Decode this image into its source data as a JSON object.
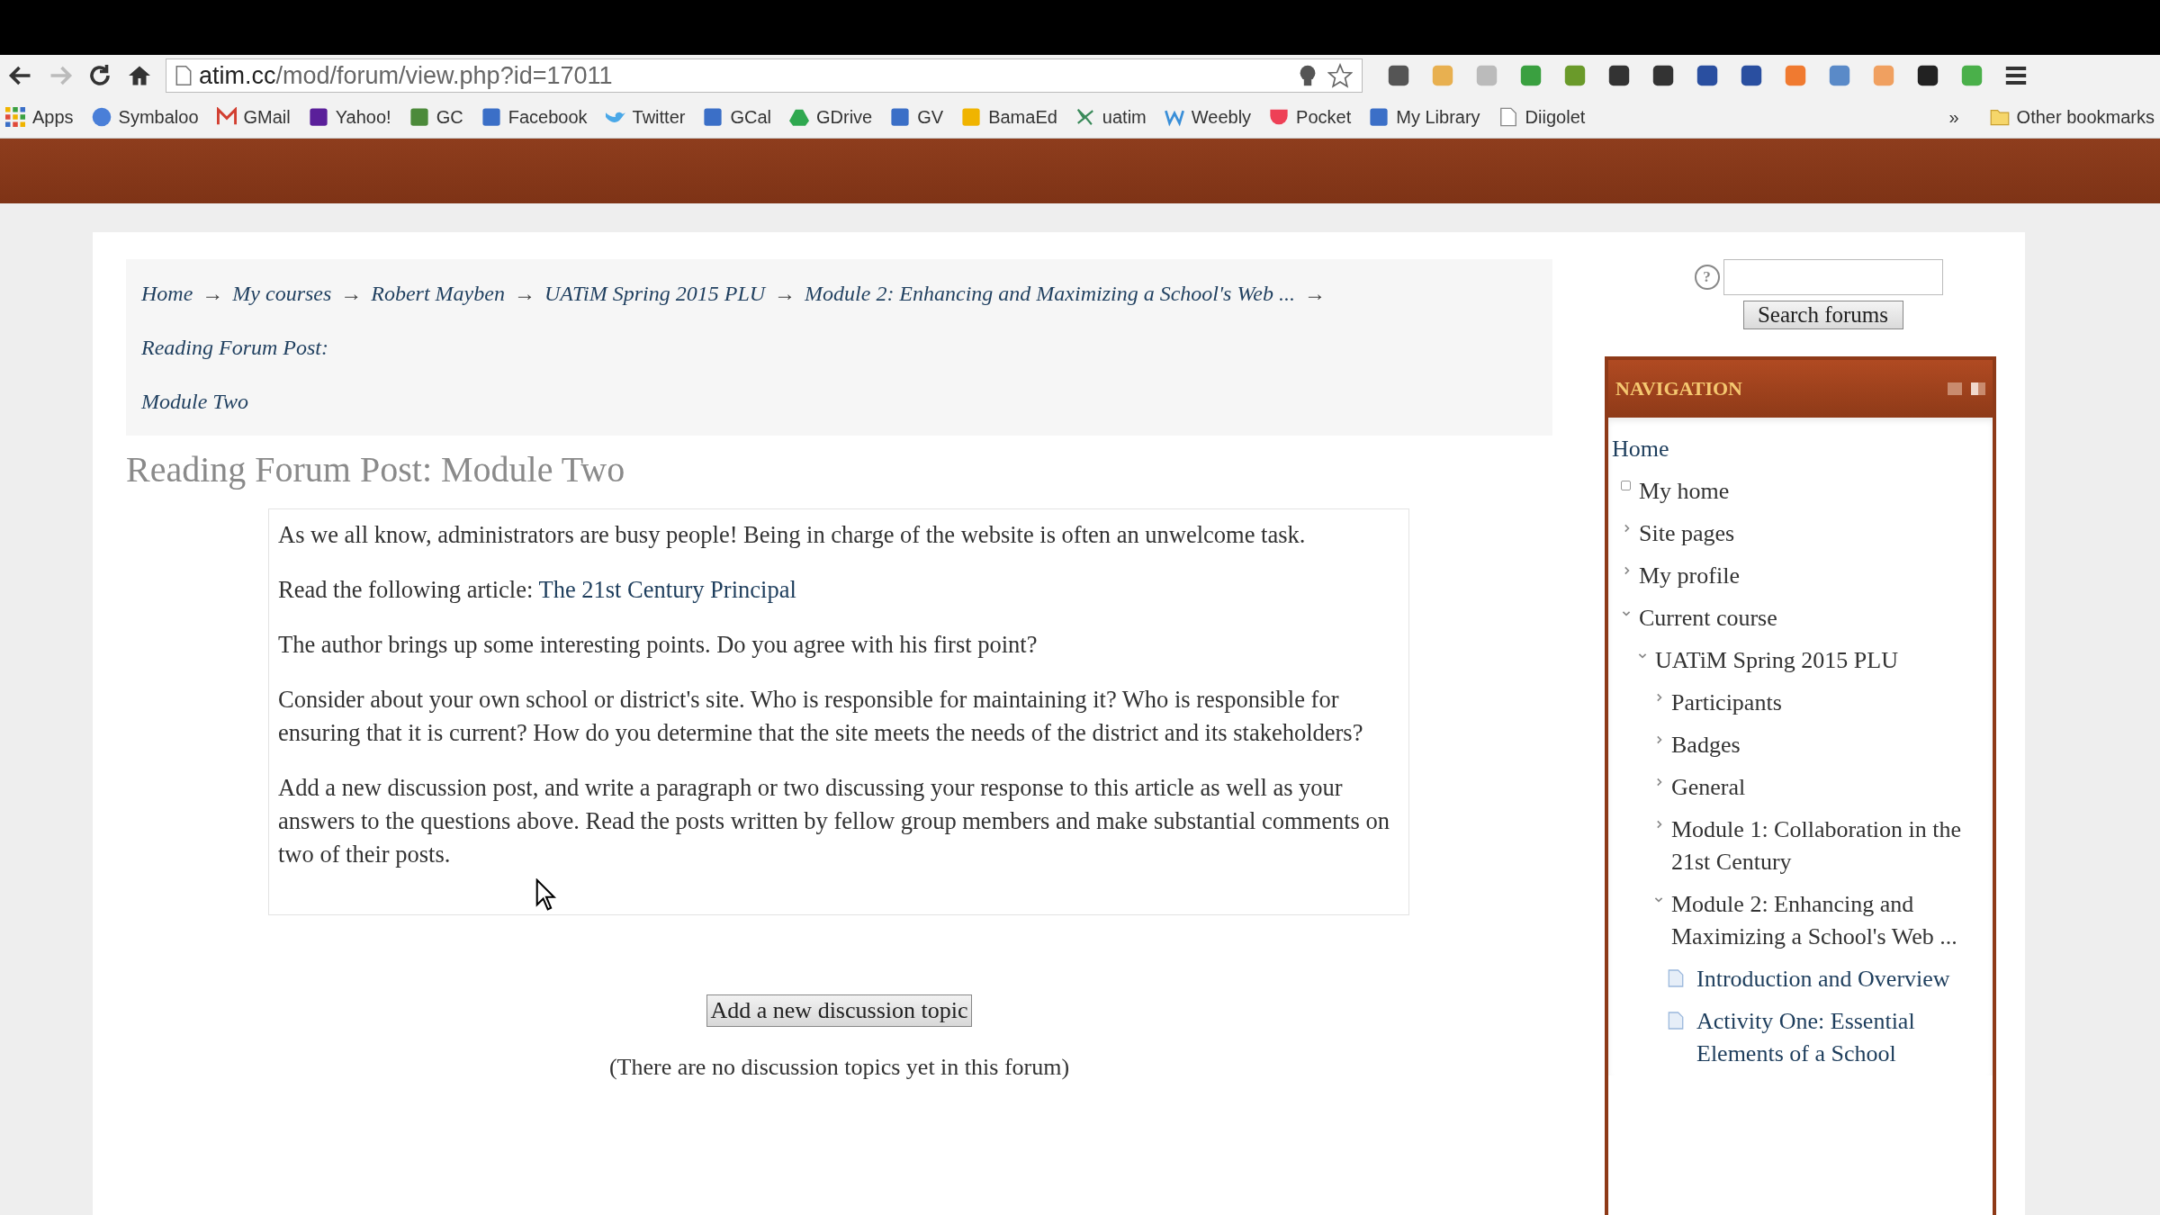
{
  "browser": {
    "url": {
      "host": "atim.cc",
      "path": "/mod/forum/view.php?id=17011"
    },
    "forward_disabled": true,
    "bookmarks": [
      {
        "label": "Apps"
      },
      {
        "label": "Symbaloo"
      },
      {
        "label": "GMail"
      },
      {
        "label": "Yahoo!"
      },
      {
        "label": "GC"
      },
      {
        "label": "Facebook"
      },
      {
        "label": "Twitter"
      },
      {
        "label": "GCal"
      },
      {
        "label": "GDrive"
      },
      {
        "label": "GV"
      },
      {
        "label": "BamaEd"
      },
      {
        "label": "uatim"
      },
      {
        "label": "Weebly"
      },
      {
        "label": "Pocket"
      },
      {
        "label": "My Library"
      },
      {
        "label": "Diigolet"
      }
    ],
    "more": "»",
    "other_bookmarks": "Other bookmarks"
  },
  "breadcrumb": {
    "separator": "→",
    "items": [
      "Home",
      "My courses",
      "Robert Mayben",
      "UATiM Spring 2015 PLU",
      "Module 2: Enhancing and Maximizing a School's Web ...",
      "Reading Forum Post: Module Two"
    ]
  },
  "heading": "Reading Forum Post: Module Two",
  "intro": [
    {
      "text": "As we all know, administrators are busy people!  Being in charge of the website is often an unwelcome task."
    },
    {
      "text": "Read the following article:  ",
      "link": "The 21st Century Principal"
    },
    {
      "text": "The author brings up some interesting points.  Do you agree with his first point?"
    },
    {
      "text": "Consider about your own school or district's site.  Who is responsible for maintaining it?  Who is responsible for ensuring that it is current?  How do you determine that the site meets the needs of the district and its stakeholders?"
    },
    {
      "text": "Add a new discussion post, and write a paragraph or two discussing your response to this article as well as your answers to the questions above.  Read the posts written by fellow group members and make substantial comments on two of their posts."
    }
  ],
  "add_button": "Add a new discussion topic",
  "empty_note": "(There are no discussion topics yet in this forum)",
  "search": {
    "help": "?",
    "button": "Search forums"
  },
  "navigation": {
    "title": "NAVIGATION",
    "tree": [
      {
        "label": "Home",
        "kind": "root",
        "children": [
          {
            "label": "My home",
            "kind": "leaf"
          },
          {
            "label": "Site pages",
            "kind": "branch",
            "expanded": false
          },
          {
            "label": "My profile",
            "kind": "branch",
            "expanded": false
          },
          {
            "label": "Current course",
            "kind": "branch",
            "expanded": true,
            "children": [
              {
                "label": "UATiM Spring 2015 PLU",
                "kind": "branch",
                "expanded": true,
                "children": [
                  {
                    "label": "Participants",
                    "kind": "branch",
                    "expanded": false
                  },
                  {
                    "label": "Badges",
                    "kind": "branch",
                    "expanded": false
                  },
                  {
                    "label": "General",
                    "kind": "branch",
                    "expanded": false
                  },
                  {
                    "label": "Module 1: Collaboration in the 21st Century",
                    "kind": "branch",
                    "expanded": false
                  },
                  {
                    "label": "Module 2: Enhancing and Maximizing a School's Web ...",
                    "kind": "branch",
                    "expanded": true,
                    "children": [
                      {
                        "label": "Introduction and Overview",
                        "kind": "page"
                      },
                      {
                        "label": "Activity One: Essential Elements of a School",
                        "kind": "page"
                      }
                    ]
                  }
                ]
              }
            ]
          }
        ]
      }
    ]
  }
}
